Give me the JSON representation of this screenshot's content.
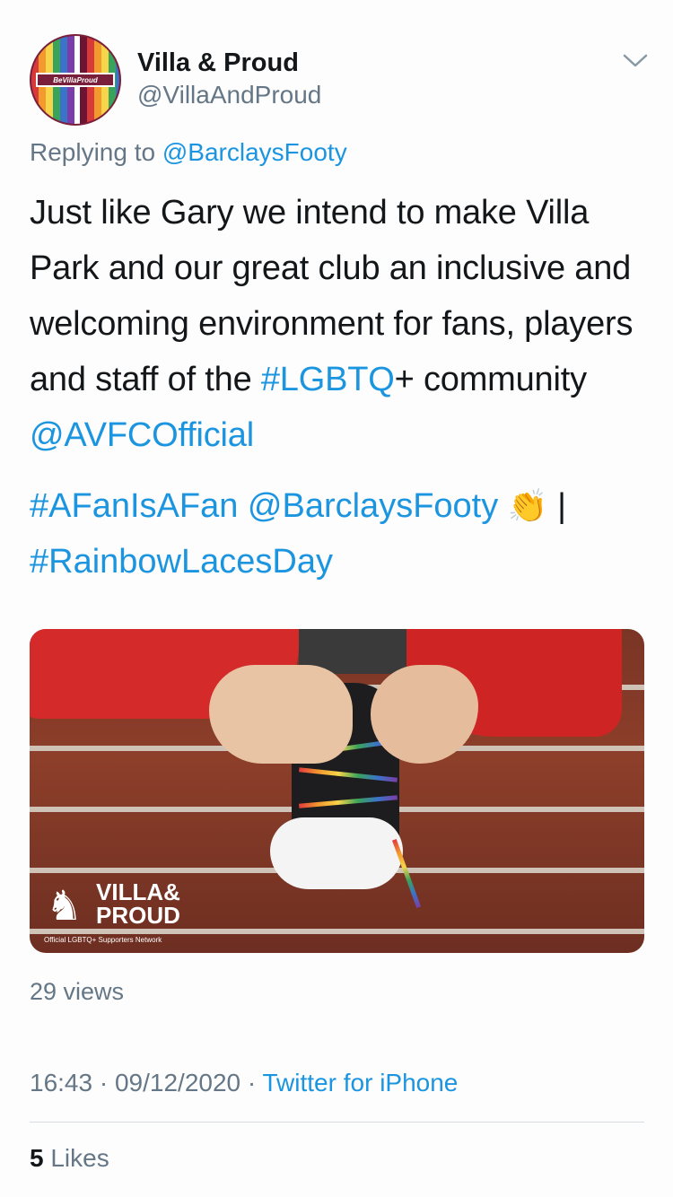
{
  "author": {
    "display_name": "Villa & Proud",
    "handle": "@VillaAndProud",
    "avatar_badge": "BeVillaProud"
  },
  "reply": {
    "prefix": "Replying to",
    "handle": "@BarclaysFooty"
  },
  "tweet": {
    "text_part1": "Just like Gary we intend to make Villa Park and our great club an inclusive and welcoming environment for fans, players and staff of the ",
    "hashtag_lgbtq": "#LGBTQ",
    "text_part2": "+ community ",
    "mention_avfc": "@AVFCOfficial",
    "hashtag_afan": "#AFanIsAFan",
    "mention_barclays": "@BarclaysFooty",
    "emoji": "👏",
    "separator": " |",
    "hashtag_rainbow": "#RainbowLacesDay"
  },
  "media": {
    "logo_title": "VILLA& PROUD",
    "logo_subtitle": "Official LGBTQ+ Supporters Network",
    "views": "29 views"
  },
  "meta": {
    "time": "16:43",
    "dot": " · ",
    "date": "09/12/2020",
    "dot2": " · ",
    "source": "Twitter for iPhone"
  },
  "stats": {
    "likes_count": "5",
    "likes_label": " Likes"
  },
  "colors": {
    "link": "#1b95e0",
    "secondary": "#657786",
    "primary": "#14171a"
  },
  "icons": {
    "chevron": "chevron-down-icon"
  }
}
